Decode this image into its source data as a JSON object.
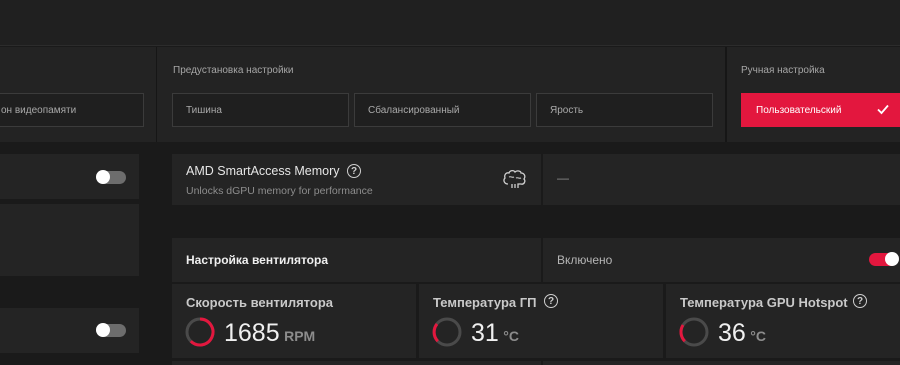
{
  "presets": {
    "partial_left_label": "он видеопамяти",
    "section_label": "Предустановка настройки",
    "items": [
      {
        "label": "Тишина"
      },
      {
        "label": "Сбалансированный"
      },
      {
        "label": "Ярость"
      }
    ],
    "manual_label": "Ручная настройка",
    "manual_item": "Пользовательский"
  },
  "smart_access": {
    "title": "AMD SmartAccess Memory",
    "help": "?",
    "subtitle": "Unlocks dGPU memory for performance",
    "value": "—"
  },
  "fan": {
    "title": "Настройка вентилятора",
    "status": "Включено",
    "enabled": true
  },
  "metrics": [
    {
      "title": "Скорость вентилятора",
      "value": "1685",
      "unit": "RPM"
    },
    {
      "title": "Температура ГП",
      "help": "?",
      "value": "31",
      "unit": "°C"
    },
    {
      "title": "Температура GPU Hotspot",
      "help": "?",
      "value": "36",
      "unit": "°C"
    }
  ],
  "left_toggles": [
    {
      "enabled": false
    },
    {
      "enabled": false
    }
  ],
  "colors": {
    "accent": "#e3173e",
    "background": "#1a1a1a",
    "card": "#242424"
  }
}
